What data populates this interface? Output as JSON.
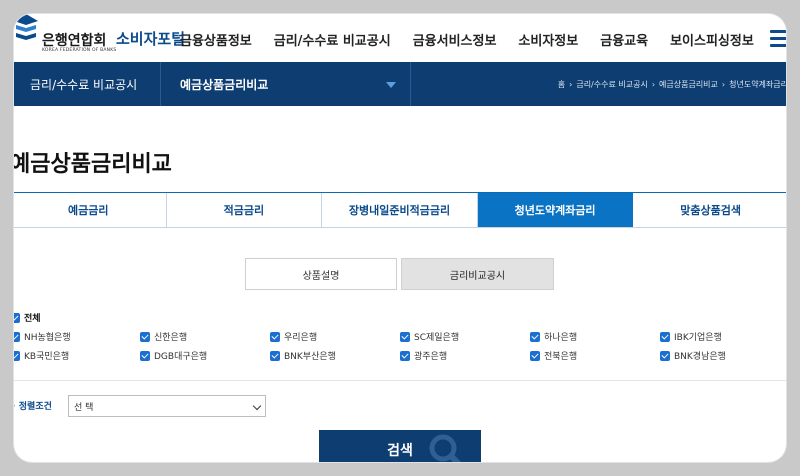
{
  "header": {
    "org_name": "은행연합회",
    "org_sub": "KOREA FEDERATION OF BANKS",
    "portal_name": "소비자포털",
    "menu": [
      "금융상품정보",
      "금리/수수료 비교공시",
      "금융서비스정보",
      "소비자정보",
      "금융교육",
      "보이스피싱정보"
    ]
  },
  "navbar": {
    "section": "금리/수수료 비교공시",
    "current": "예금상품금리비교",
    "breadcrumb": [
      "홈",
      "금리/수수료 비교공시",
      "예금상품금리비교",
      "청년도약계좌금리"
    ]
  },
  "page": {
    "title": "예금상품금리비교"
  },
  "tabs": [
    "예금금리",
    "적금금리",
    "장병내일준비적금금리",
    "청년도약계좌금리",
    "맞춤상품검색"
  ],
  "active_tab": 3,
  "subtabs": [
    "상품설명",
    "금리비교공시"
  ],
  "filters": {
    "all_label": "전체",
    "banks": [
      "NH농협은행",
      "신한은행",
      "우리은행",
      "SC제일은행",
      "하나은행",
      "IBK기업은행",
      "KB국민은행",
      "DGB대구은행",
      "BNK부산은행",
      "광주은행",
      "전북은행",
      "BNK경남은행"
    ],
    "checked": true
  },
  "sort": {
    "label": "정렬조건",
    "value": "선 택"
  },
  "search": {
    "label": "검색"
  },
  "colors": {
    "navy": "#0e3d72",
    "accent": "#0b73c4",
    "checkbox": "#1a6fd0"
  }
}
